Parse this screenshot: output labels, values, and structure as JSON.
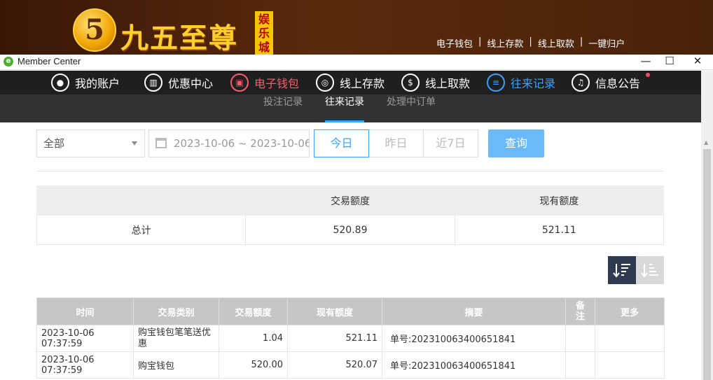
{
  "site": {
    "logo_badge": "5",
    "logo_text": "九五至尊",
    "logo_tag": "娱乐城",
    "top_links": [
      "电子钱包",
      "线上存款",
      "线上取款",
      "一键归户"
    ]
  },
  "window": {
    "title": "Member Center",
    "minimize": "—",
    "maximize": "☐",
    "close": "✕"
  },
  "main_nav": [
    {
      "label": "我的账户",
      "icon": "user-icon"
    },
    {
      "label": "优惠中心",
      "icon": "gift-icon"
    },
    {
      "label": "电子钱包",
      "icon": "wallet-icon",
      "color": "#ff5b6b"
    },
    {
      "label": "线上存款",
      "icon": "deposit-icon"
    },
    {
      "label": "线上取款",
      "icon": "withdraw-icon"
    },
    {
      "label": "往来记录",
      "icon": "records-icon",
      "color": "#3aa2ff"
    },
    {
      "label": "信息公告",
      "icon": "bell-icon"
    }
  ],
  "sub_nav": [
    "投注记录",
    "往来记录",
    "处理中订单"
  ],
  "sub_nav_active": "往来记录",
  "filter": {
    "type_value": "全部",
    "date_range": "2023-10-06 ~ 2023-10-06",
    "quick": [
      "今日",
      "昨日",
      "近7日"
    ],
    "quick_active": "今日",
    "query_label": "查询"
  },
  "summary": {
    "headers": [
      "",
      "交易额度",
      "现有额度"
    ],
    "row": [
      "总计",
      "520.89",
      "521.11"
    ]
  },
  "records": {
    "headers": [
      "时间",
      "交易类别",
      "交易额度",
      "现有额度",
      "摘要",
      "备注",
      "更多"
    ],
    "rows": [
      [
        "2023-10-06 07:37:59",
        "购宝钱包笔笔送优惠",
        "1.04",
        "521.11",
        "单号:202310063400651841",
        "",
        ""
      ],
      [
        "2023-10-06 07:37:59",
        "购宝钱包",
        "520.00",
        "520.07",
        "单号:202310063400651841",
        "",
        ""
      ]
    ]
  },
  "colors": {
    "accent": "#3aa2ff",
    "query_button": "#6ab9f8",
    "nav_bg": "#1f1f1f",
    "wallet_red": "#ff5b6b"
  }
}
